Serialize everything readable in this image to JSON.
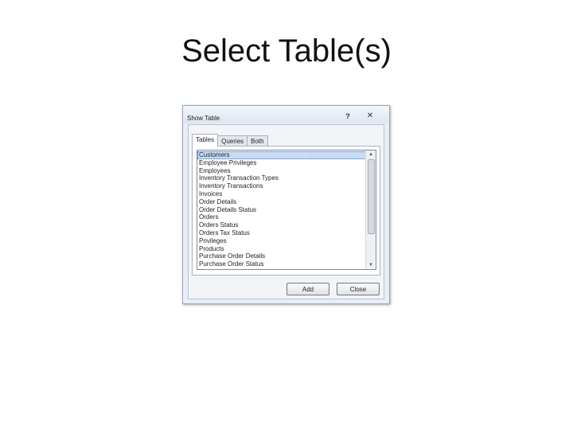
{
  "slide": {
    "title": "Select Table(s)"
  },
  "dialog": {
    "title": "Show Table",
    "help_icon": "help-icon",
    "close_icon": "close-icon",
    "help_glyph": "?",
    "close_glyph": "✕",
    "tabs": [
      {
        "label": "Tables",
        "active": true
      },
      {
        "label": "Queries",
        "active": false
      },
      {
        "label": "Both",
        "active": false
      }
    ],
    "list": {
      "selected_index": 0,
      "items": [
        "Customers",
        "Employee Privileges",
        "Employees",
        "Inventory Transaction Types",
        "Inventory Transactions",
        "Invoices",
        "Order Details",
        "Order Details Status",
        "Orders",
        "Orders Status",
        "Orders Tax Status",
        "Privileges",
        "Products",
        "Purchase Order Details",
        "Purchase Order Status"
      ],
      "scroll_up_glyph": "▲",
      "scroll_down_glyph": "▼"
    },
    "buttons": {
      "add_label": "Add",
      "close_label": "Close"
    }
  },
  "colors": {
    "selection": "#c7dcf5",
    "dialog_background": "#e9eef5"
  }
}
